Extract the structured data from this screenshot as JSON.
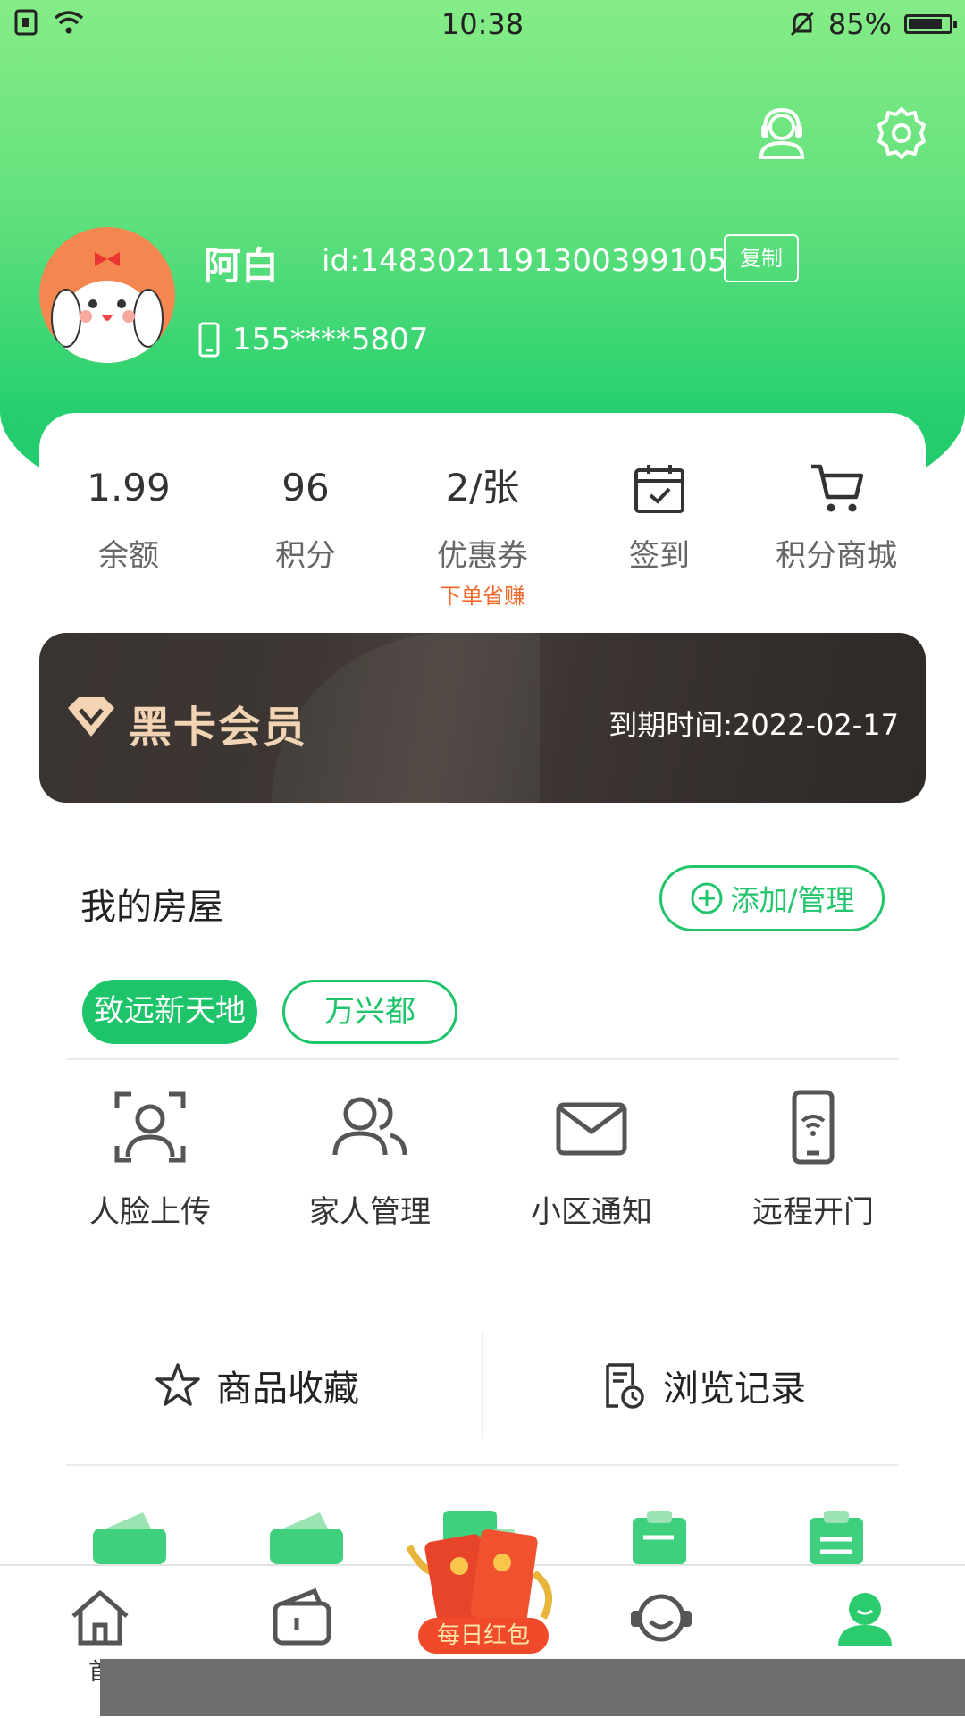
{
  "status_bar": {
    "time": "10:38",
    "battery": "85%",
    "battery_level": 0.85
  },
  "profile": {
    "name": "阿白",
    "id_text": "id:1483021191300399105",
    "copy_label": "复制",
    "phone": "155****5807"
  },
  "stats": [
    {
      "value": "1.99",
      "label": "余额"
    },
    {
      "value": "96",
      "label": "积分"
    },
    {
      "value": "2/张",
      "label": "优惠券",
      "sub": "下单省赚"
    },
    {
      "icon": "calendar-check-icon",
      "label": "签到"
    },
    {
      "icon": "cart-icon",
      "label": "积分商城"
    }
  ],
  "vip": {
    "title": "黑卡会员",
    "expiry": "到期时间:2022-02-17"
  },
  "house": {
    "title": "我的房屋",
    "add_label": "添加/管理",
    "tags": [
      "致远新天地",
      "万兴都"
    ]
  },
  "functions": [
    {
      "label": "人脸上传",
      "icon": "face-scan-icon"
    },
    {
      "label": "家人管理",
      "icon": "family-icon"
    },
    {
      "label": "小区通知",
      "icon": "mail-icon"
    },
    {
      "label": "远程开门",
      "icon": "phone-wifi-icon"
    }
  ],
  "links": {
    "favorites": "商品收藏",
    "history": "浏览记录"
  },
  "tabbar": {
    "home_label": "首",
    "red_packet_label": "每日红包"
  },
  "colors": {
    "brand_green": "#1ec46a",
    "accent_orange": "#f06a2b",
    "vip_gold": "#f2d3b4"
  }
}
